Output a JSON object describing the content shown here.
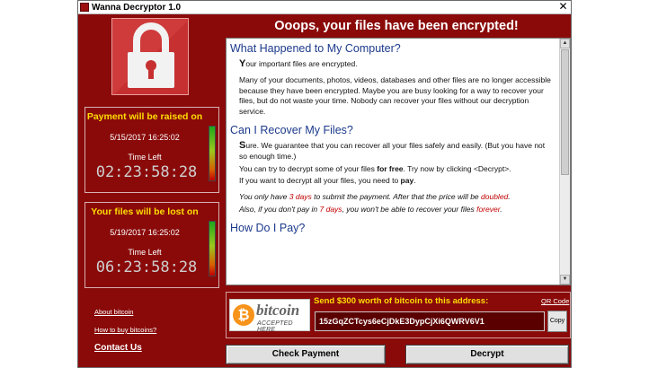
{
  "window": {
    "title": "Wanna Decryptor 1.0",
    "close_glyph": "✕"
  },
  "heading": "Ooops, your files have been encrypted!",
  "timers": [
    {
      "title": "Payment will be raised on",
      "date": "5/15/2017 16:25:02",
      "time_left_label": "Time Left",
      "countdown": "02:23:58:28"
    },
    {
      "title": "Your files will be lost on",
      "date": "5/19/2017 16:25:02",
      "time_left_label": "Time Left",
      "countdown": "06:23:58:28"
    }
  ],
  "links": {
    "about": "About bitcoin",
    "how_to_buy": "How to buy bitcoins?",
    "contact": "Contact Us"
  },
  "content": {
    "h1": "What Happened to My Computer?",
    "p1_first": "Y",
    "p1_rest": "our important files are encrypted.",
    "p2": "Many of your documents, photos, videos, databases and other files are no longer accessible because they have been encrypted. Maybe you are busy looking for a way to recover your files, but do not waste your time. Nobody can recover your files without our decryption service.",
    "h2": "Can I Recover My Files?",
    "p3_first": "S",
    "p3_rest": "ure. We guarantee that you can recover all your files safely and easily. (But you have not so enough time.)",
    "p4_a": "You can try to decrypt some of your files ",
    "p4_b": "for free",
    "p4_c": ". Try now by clicking <Decrypt>.",
    "p5_a": "If you want to decrypt all your files, you need to ",
    "p5_b": "pay",
    "p5_c": ".",
    "p6_a": "You only have ",
    "p6_b": "3 days",
    "p6_c": " to submit the payment. After that the price will be ",
    "p6_d": "doubled",
    "p6_e": ".",
    "p7_a": "Also, if you don't pay in ",
    "p7_b": "7 days",
    "p7_c": ", you won't be able to recover your files ",
    "p7_d": "forever",
    "p7_e": ".",
    "h3": "How Do I Pay?"
  },
  "payment": {
    "logo_word": "bitcoin",
    "logo_sub": "ACCEPTED HERE",
    "send_label": "Send $300 worth of bitcoin to this address:",
    "qr_link": "QR Code",
    "address": "15zGqZCTcys6eCjDkE3DypCjXi6QWRV6V1",
    "copy": "Copy"
  },
  "buttons": {
    "check_payment": "Check Payment",
    "decrypt": "Decrypt"
  },
  "colors": {
    "window_bg": "#8a0a0a",
    "accent_yellow": "#ffde00",
    "heading_blue": "#1c3a8c",
    "warning_red": "#c00000"
  },
  "icons": {
    "lock": "padlock-icon",
    "bitcoin": "bitcoin-icon"
  },
  "scrollbar": {
    "up": "▲",
    "down": "▼"
  }
}
